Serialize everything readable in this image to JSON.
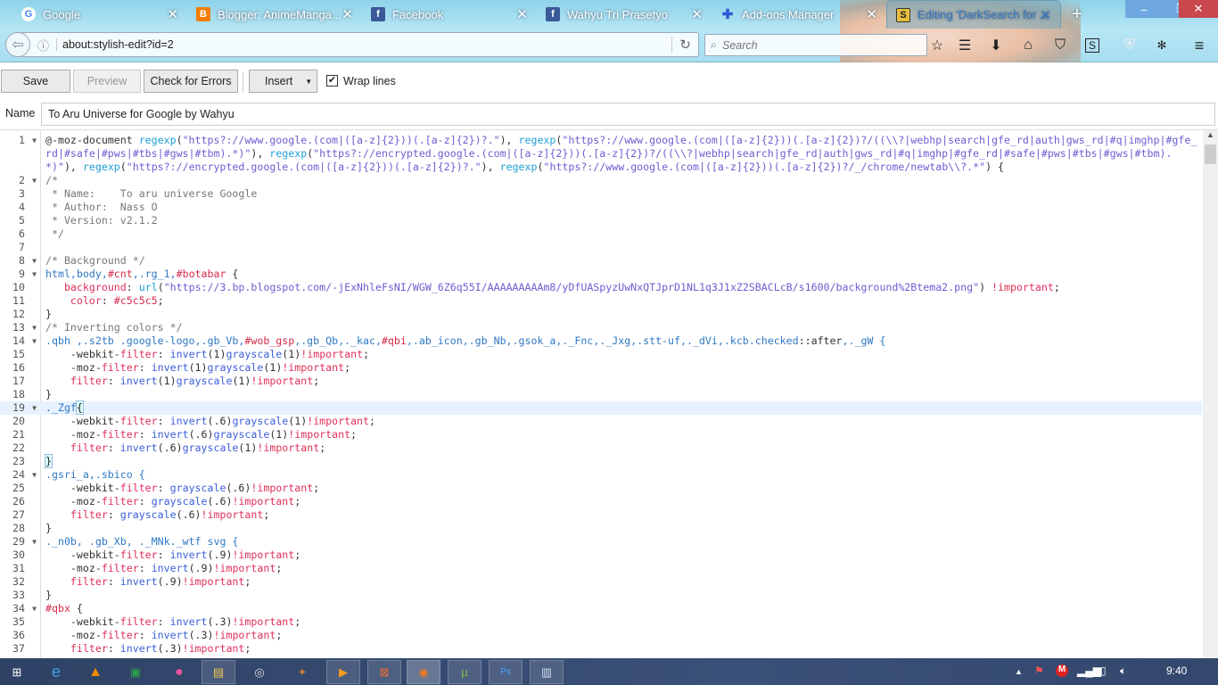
{
  "browser": {
    "tabs": [
      {
        "title": "Google",
        "icon": "google-icon"
      },
      {
        "title": "Blogger: AnimeManga...",
        "icon": "blogger-icon"
      },
      {
        "title": "Facebook",
        "icon": "facebook-icon"
      },
      {
        "title": "Wahyu Tri Prasetyo",
        "icon": "facebook-icon"
      },
      {
        "title": "Add-ons Manager",
        "icon": "puzzle-icon"
      },
      {
        "title": "Editing 'DarkSearch for ...",
        "icon": "stylish-icon",
        "active": true
      }
    ],
    "url": "about:stylish-edit?id=2",
    "search_placeholder": "Search"
  },
  "toolbar": {
    "save": "Save",
    "preview": "Preview",
    "check": "Check for Errors",
    "insert": "Insert",
    "wrap_label": "Wrap lines",
    "wrap_checked": true
  },
  "name": {
    "label": "Name",
    "value": "To Aru Universe for Google by Wahyu"
  },
  "editor": {
    "lines": [
      {
        "n": "1",
        "fold": true,
        "t": [
          [
            "@-moz-document ",
            "d"
          ],
          [
            "regexp",
            "f"
          ],
          [
            "(",
            "d"
          ],
          [
            "\"https?://www.google.(com|([a-z]{2}))(.[a-z]{2})?.\"",
            "s"
          ],
          [
            "), ",
            "d"
          ],
          [
            "regexp",
            "f"
          ],
          [
            "(",
            "d"
          ],
          [
            "\"https?://www.google.(com|([a-z]{2}))(.[a-z]{2})?/((\\\\?|webhp|search|gfe_rd|auth|gws_rd|#q|imghp|#gfe_rd|#safe|#pws|#tbs|#gws|#tbm).*)\"",
            "s"
          ],
          [
            "), ",
            "d"
          ],
          [
            "regexp",
            "f"
          ],
          [
            "(",
            "d"
          ],
          [
            "\"https?://encrypted.google.(com|([a-z]{2}))(.[a-z]{2})?/((\\\\?|webhp|search|gfe_rd|auth|gws_rd|#q|imghp|#gfe_rd|#safe|#pws|#tbs|#gws|#tbm).*)\"",
            "s"
          ],
          [
            "), ",
            "d"
          ],
          [
            "regexp",
            "f"
          ],
          [
            "(",
            "d"
          ],
          [
            "\"https?://encrypted.google.(com|([a-z]{2}))(.[a-z]{2})?.\"",
            "s"
          ],
          [
            "), ",
            "d"
          ],
          [
            "regexp",
            "f"
          ],
          [
            "(",
            "d"
          ],
          [
            "\"https?://www.google.(com|([a-z]{2}))(.[a-z]{2})?/_/chrome/newtab\\\\?.*\"",
            "s"
          ],
          [
            ") {",
            "d"
          ]
        ]
      },
      {
        "n": "2",
        "fold": true,
        "t": [
          [
            "/*",
            "c"
          ]
        ]
      },
      {
        "n": "3",
        "t": [
          [
            " * Name:    To aru universe Google",
            "c"
          ]
        ]
      },
      {
        "n": "4",
        "t": [
          [
            " * Author:  Nass O",
            "c"
          ]
        ]
      },
      {
        "n": "5",
        "t": [
          [
            " * Version: v2.1.2",
            "c"
          ]
        ]
      },
      {
        "n": "6",
        "t": [
          [
            " */",
            "c"
          ]
        ]
      },
      {
        "n": "7",
        "t": []
      },
      {
        "n": "8",
        "fold": true,
        "t": [
          [
            "/* Background */",
            "c"
          ]
        ]
      },
      {
        "n": "9",
        "fold": true,
        "t": [
          [
            "html,body,",
            "sel"
          ],
          [
            "#cnt",
            "h"
          ],
          [
            ",.rg_1,",
            "sel"
          ],
          [
            "#botabar",
            "h"
          ],
          [
            " {",
            "d"
          ]
        ]
      },
      {
        "n": "10",
        "t": [
          [
            "   ",
            "d"
          ],
          [
            "background",
            "p"
          ],
          [
            ": ",
            "d"
          ],
          [
            "url",
            "f"
          ],
          [
            "(",
            "d"
          ],
          [
            "\"https://3.bp.blogspot.com/-jExNhleFsNI/WGW_6Z6q55I/AAAAAAAAAm8/yDfUASpyzUwNxQTJprD1NL1q3J1xZ2SBACLcB/s1600/background%2Btema2.png\"",
            "s"
          ],
          [
            ") ",
            "d"
          ],
          [
            "!important",
            "i"
          ],
          [
            ";",
            "d"
          ]
        ]
      },
      {
        "n": "11",
        "t": [
          [
            "    ",
            "d"
          ],
          [
            "color",
            "p"
          ],
          [
            ": ",
            "d"
          ],
          [
            "#c5c5c5",
            "h"
          ],
          [
            ";",
            "d"
          ]
        ]
      },
      {
        "n": "12",
        "t": [
          [
            "}",
            "d"
          ]
        ]
      },
      {
        "n": "13",
        "fold": true,
        "t": [
          [
            "/* Inverting colors */",
            "c"
          ]
        ]
      },
      {
        "n": "14",
        "fold": true,
        "t": [
          [
            ".qbh ,.s2tb .google-logo,.gb_Vb,",
            "sel"
          ],
          [
            "#wob_gsp",
            "h"
          ],
          [
            ",.gb_Qb,._kac,",
            "sel"
          ],
          [
            "#qbi",
            "h"
          ],
          [
            ",.ab_icon,.gb_Nb,.gsok_a,._Fnc,._Jxg,.stt-uf,._dVi,.kcb.checked",
            "sel"
          ],
          [
            "::after",
            "d"
          ],
          [
            ",._gW {",
            "sel"
          ]
        ]
      },
      {
        "n": "15",
        "t": [
          [
            "    -webkit-",
            "d"
          ],
          [
            "filter",
            "p"
          ],
          [
            ": ",
            "d"
          ],
          [
            "invert",
            "v"
          ],
          [
            "(1)",
            "d"
          ],
          [
            "grayscale",
            "v"
          ],
          [
            "(1)",
            "d"
          ],
          [
            "!important",
            "i"
          ],
          [
            ";",
            "d"
          ]
        ]
      },
      {
        "n": "16",
        "t": [
          [
            "    -moz-",
            "d"
          ],
          [
            "filter",
            "p"
          ],
          [
            ": ",
            "d"
          ],
          [
            "invert",
            "v"
          ],
          [
            "(1)",
            "d"
          ],
          [
            "grayscale",
            "v"
          ],
          [
            "(1)",
            "d"
          ],
          [
            "!important",
            "i"
          ],
          [
            ";",
            "d"
          ]
        ]
      },
      {
        "n": "17",
        "t": [
          [
            "    ",
            "d"
          ],
          [
            "filter",
            "p"
          ],
          [
            ": ",
            "d"
          ],
          [
            "invert",
            "v"
          ],
          [
            "(1)",
            "d"
          ],
          [
            "grayscale",
            "v"
          ],
          [
            "(1)",
            "d"
          ],
          [
            "!important",
            "i"
          ],
          [
            ";",
            "d"
          ]
        ]
      },
      {
        "n": "18",
        "t": [
          [
            "}",
            "d"
          ]
        ]
      },
      {
        "n": "19",
        "fold": true,
        "hl": true,
        "t": [
          [
            "._Zgf",
            "sel"
          ],
          [
            "{",
            "bm"
          ]
        ]
      },
      {
        "n": "20",
        "t": [
          [
            "    -webkit-",
            "d"
          ],
          [
            "filter",
            "p"
          ],
          [
            ": ",
            "d"
          ],
          [
            "invert",
            "v"
          ],
          [
            "(.6)",
            "d"
          ],
          [
            "grayscale",
            "v"
          ],
          [
            "(1)",
            "d"
          ],
          [
            "!important",
            "i"
          ],
          [
            ";",
            "d"
          ]
        ]
      },
      {
        "n": "21",
        "t": [
          [
            "    -moz-",
            "d"
          ],
          [
            "filter",
            "p"
          ],
          [
            ": ",
            "d"
          ],
          [
            "invert",
            "v"
          ],
          [
            "(.6)",
            "d"
          ],
          [
            "grayscale",
            "v"
          ],
          [
            "(1)",
            "d"
          ],
          [
            "!important",
            "i"
          ],
          [
            ";",
            "d"
          ]
        ]
      },
      {
        "n": "22",
        "t": [
          [
            "    ",
            "d"
          ],
          [
            "filter",
            "p"
          ],
          [
            ": ",
            "d"
          ],
          [
            "invert",
            "v"
          ],
          [
            "(.6)",
            "d"
          ],
          [
            "grayscale",
            "v"
          ],
          [
            "(1)",
            "d"
          ],
          [
            "!important",
            "i"
          ],
          [
            ";",
            "d"
          ]
        ]
      },
      {
        "n": "23",
        "t": [
          [
            "}",
            "bm"
          ]
        ]
      },
      {
        "n": "24",
        "fold": true,
        "t": [
          [
            ".gsri_a,.sbico {",
            "sel"
          ]
        ]
      },
      {
        "n": "25",
        "t": [
          [
            "    -webkit-",
            "d"
          ],
          [
            "filter",
            "p"
          ],
          [
            ": ",
            "d"
          ],
          [
            "grayscale",
            "v"
          ],
          [
            "(.6)",
            "d"
          ],
          [
            "!important",
            "i"
          ],
          [
            ";",
            "d"
          ]
        ]
      },
      {
        "n": "26",
        "t": [
          [
            "    -moz-",
            "d"
          ],
          [
            "filter",
            "p"
          ],
          [
            ": ",
            "d"
          ],
          [
            "grayscale",
            "v"
          ],
          [
            "(.6)",
            "d"
          ],
          [
            "!important",
            "i"
          ],
          [
            ";",
            "d"
          ]
        ]
      },
      {
        "n": "27",
        "t": [
          [
            "    ",
            "d"
          ],
          [
            "filter",
            "p"
          ],
          [
            ": ",
            "d"
          ],
          [
            "grayscale",
            "v"
          ],
          [
            "(.6)",
            "d"
          ],
          [
            "!important",
            "i"
          ],
          [
            ";",
            "d"
          ]
        ]
      },
      {
        "n": "28",
        "t": [
          [
            "}",
            "d"
          ]
        ]
      },
      {
        "n": "29",
        "fold": true,
        "t": [
          [
            "._n0b, .gb_Xb, ._MNk._wtf svg {",
            "sel"
          ]
        ]
      },
      {
        "n": "30",
        "t": [
          [
            "    -webkit-",
            "d"
          ],
          [
            "filter",
            "p"
          ],
          [
            ": ",
            "d"
          ],
          [
            "invert",
            "v"
          ],
          [
            "(.9)",
            "d"
          ],
          [
            "!important",
            "i"
          ],
          [
            ";",
            "d"
          ]
        ]
      },
      {
        "n": "31",
        "t": [
          [
            "    -moz-",
            "d"
          ],
          [
            "filter",
            "p"
          ],
          [
            ": ",
            "d"
          ],
          [
            "invert",
            "v"
          ],
          [
            "(.9)",
            "d"
          ],
          [
            "!important",
            "i"
          ],
          [
            ";",
            "d"
          ]
        ]
      },
      {
        "n": "32",
        "t": [
          [
            "    ",
            "d"
          ],
          [
            "filter",
            "p"
          ],
          [
            ": ",
            "d"
          ],
          [
            "invert",
            "v"
          ],
          [
            "(.9)",
            "d"
          ],
          [
            "!important",
            "i"
          ],
          [
            ";",
            "d"
          ]
        ]
      },
      {
        "n": "33",
        "t": [
          [
            "}",
            "d"
          ]
        ]
      },
      {
        "n": "34",
        "fold": true,
        "t": [
          [
            "#qbx",
            "h"
          ],
          [
            " {",
            "d"
          ]
        ]
      },
      {
        "n": "35",
        "t": [
          [
            "    -webkit-",
            "d"
          ],
          [
            "filter",
            "p"
          ],
          [
            ": ",
            "d"
          ],
          [
            "invert",
            "v"
          ],
          [
            "(.3)",
            "d"
          ],
          [
            "!important",
            "i"
          ],
          [
            ";",
            "d"
          ]
        ]
      },
      {
        "n": "36",
        "t": [
          [
            "    -moz-",
            "d"
          ],
          [
            "filter",
            "p"
          ],
          [
            ": ",
            "d"
          ],
          [
            "invert",
            "v"
          ],
          [
            "(.3)",
            "d"
          ],
          [
            "!important",
            "i"
          ],
          [
            ";",
            "d"
          ]
        ]
      },
      {
        "n": "37",
        "t": [
          [
            "    ",
            "d"
          ],
          [
            "filter",
            "p"
          ],
          [
            ": ",
            "d"
          ],
          [
            "invert",
            "v"
          ],
          [
            "(.3)",
            "d"
          ],
          [
            "!important",
            "i"
          ],
          [
            ";",
            "d"
          ]
        ]
      }
    ]
  },
  "taskbar": {
    "clock": "9:40",
    "apps": [
      "internet-explorer-icon",
      "vlc-icon",
      "spreadsheet-icon",
      "osu-icon",
      "file-explorer-icon",
      "media-icon",
      "game-icon",
      "media-player-icon",
      "xampp-icon",
      "firefox-icon",
      "utorrent-icon",
      "photoshop-icon",
      "notepad-icon"
    ]
  },
  "colors": {
    "accent": "#8fd3ea",
    "close": "#c9474d",
    "string": "#6a5fd1",
    "property": "#e0305a"
  }
}
